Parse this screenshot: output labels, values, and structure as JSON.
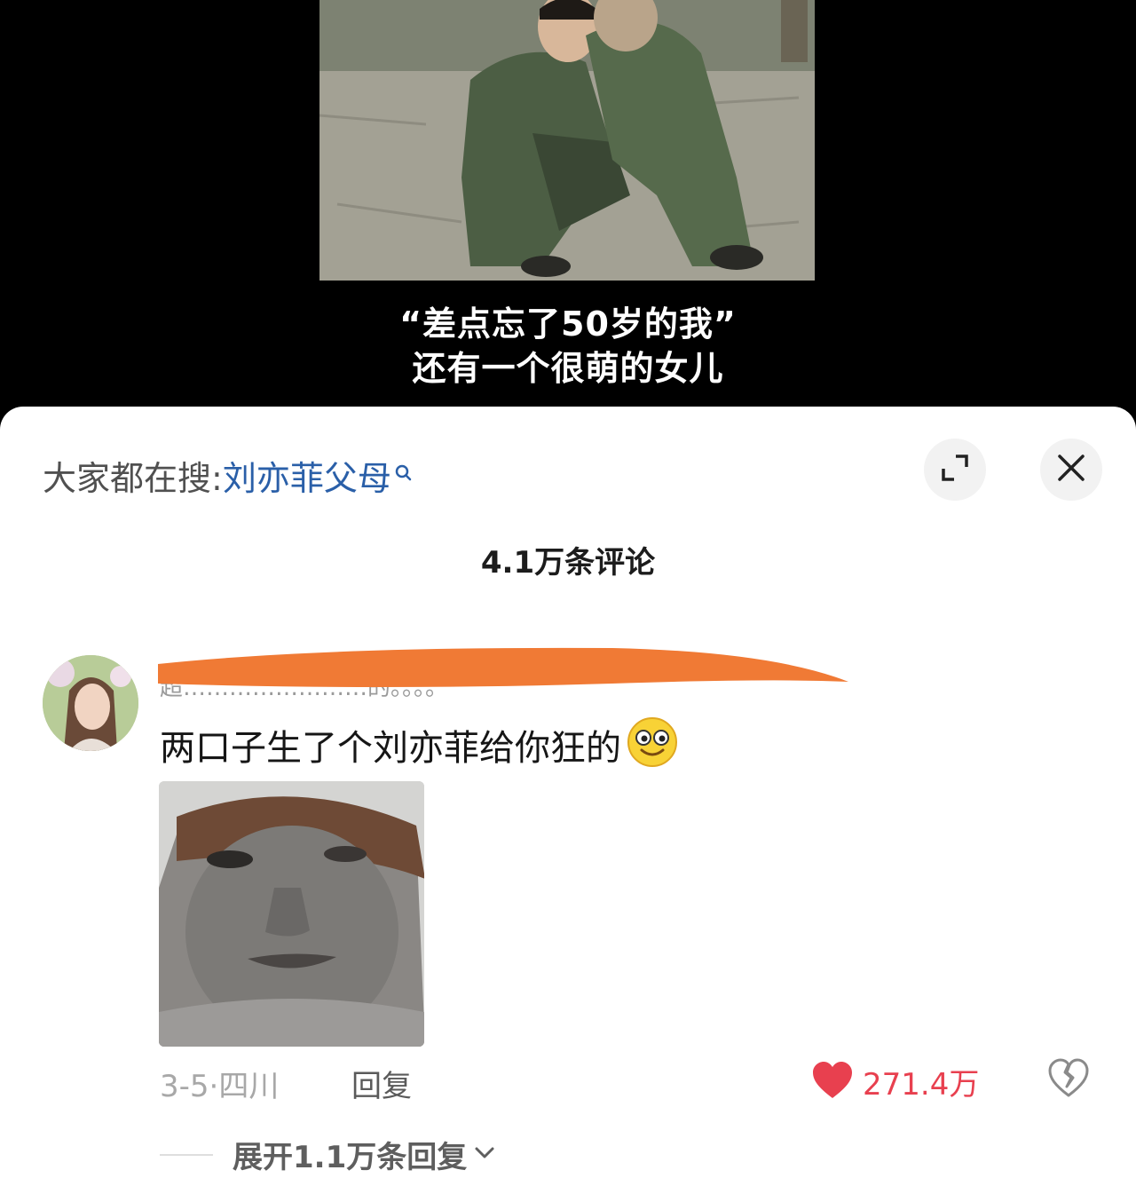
{
  "video": {
    "caption_line1": "“差点忘了50岁的我”",
    "caption_line2": "还有一个很萌的女儿"
  },
  "sheet": {
    "search_prefix": "大家都在搜:",
    "search_keyword": "刘亦菲父母",
    "comments_title": "4.1万条评论"
  },
  "comment": {
    "username_visible": "超……………………的。。。。",
    "text": "两口子生了个刘亦菲给你狂的",
    "date_location": "3-5·四川",
    "reply_label": "回复",
    "like_count": "271.4万",
    "expand_replies": "展开1.1万条回复"
  },
  "colors": {
    "link": "#2a5fa8",
    "like": "#e8404f",
    "redaction": "#f07a35"
  },
  "icons": {
    "search": "search-icon",
    "expand": "expand-icon",
    "close": "close-icon",
    "like": "heart-icon",
    "dislike": "broken-heart-icon",
    "expand_chevron": "chevron-down-icon",
    "emoji": "smiley-emoji-icon"
  }
}
